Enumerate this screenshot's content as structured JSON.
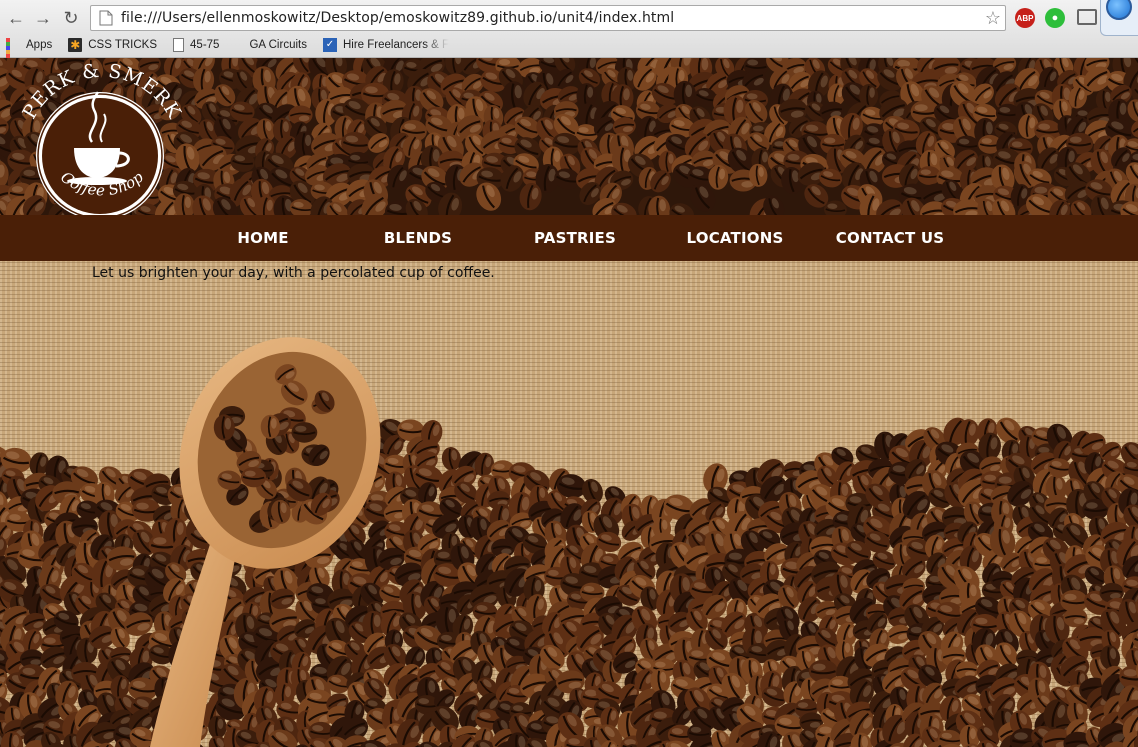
{
  "browser": {
    "url": "file:///Users/ellenmoskowitz/Desktop/emoskowitz89.github.io/unit4/index.html",
    "nav_icons": [
      "back-arrow-icon",
      "forward-arrow-icon",
      "reload-icon"
    ],
    "extensions": {
      "abp": "ABP"
    },
    "bookmarks": [
      {
        "label": "Apps",
        "icon": "apps-grid-icon"
      },
      {
        "label": "CSS TRICKS",
        "icon": "css-tricks-icon"
      },
      {
        "label": "45-75",
        "icon": "document-icon"
      },
      {
        "label": "GA Circuits",
        "icon": "blank-icon"
      },
      {
        "label": "Hire Freelancers & F",
        "icon": "freelancer-icon"
      }
    ]
  },
  "site": {
    "logo": {
      "arc_top": "PERK & SMERK",
      "arc_bottom": "Coffee Shop"
    },
    "nav": [
      "HOME",
      "BLENDS",
      "PASTRIES",
      "LOCATIONS",
      "CONTACT US"
    ],
    "tagline": "Let us brighten your day, with a percolated cup of coffee."
  },
  "colors": {
    "nav_bar": "#4a1f07",
    "logo_fill": "#4a1f07",
    "bean_dark": "#3b1d0c",
    "bean_mid": "#6b3a1a",
    "burlap": "#c7a679"
  }
}
